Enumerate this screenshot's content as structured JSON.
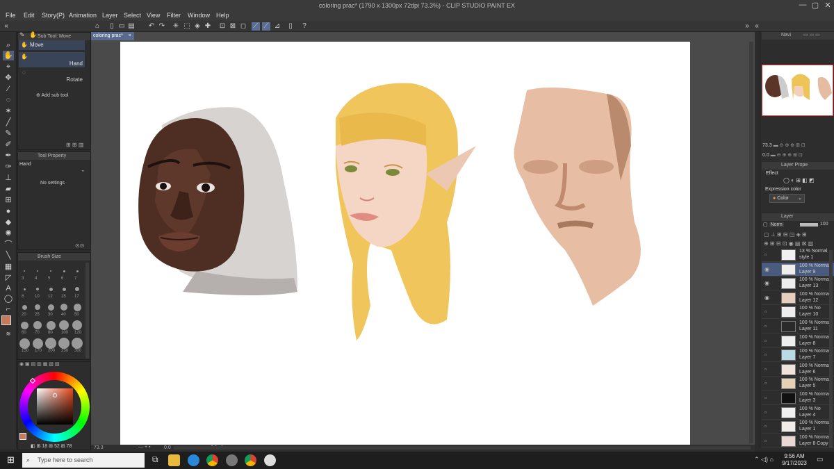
{
  "window": {
    "title": "coloring prac* (1790 x 1300px 72dpi 73.3%)  -  CLIP STUDIO PAINT EX",
    "controls": [
      "—",
      "▢",
      "✕"
    ]
  },
  "menu": [
    "File",
    "Edit",
    "Story(P)",
    "Animation",
    "Layer",
    "Select",
    "View",
    "Filter",
    "Window",
    "Help"
  ],
  "subtool_panel": {
    "header": "Sub Tool: Move",
    "items": [
      {
        "label": "Move",
        "selected": true
      },
      {
        "label": "Hand",
        "selected": true
      },
      {
        "label": "Rotate",
        "selected": false
      }
    ],
    "add_label": "Add sub tool"
  },
  "tool_property": {
    "header": "Tool Property",
    "tool_name": "Hand",
    "empty_text": "No settings"
  },
  "brush_size": {
    "header": "Brush Size",
    "sizes": [
      "3",
      "4",
      "5",
      "6",
      "7",
      "8",
      "10",
      "12",
      "15",
      "17",
      "20",
      "25",
      "30",
      "40",
      "50",
      "60",
      "70",
      "80",
      "100",
      "120",
      "150",
      "170",
      "200",
      "250",
      "300"
    ]
  },
  "color": {
    "main": "#c87a5a",
    "sub": "#ffffff",
    "readout": [
      "18",
      "52",
      "78"
    ]
  },
  "document": {
    "tab_label": "coloring prac*",
    "zoom": "73.3"
  },
  "navigator": {
    "header": "Navi",
    "zoom": "73.3",
    "angle": "0.0"
  },
  "layer_property": {
    "header": "Layer Prope",
    "effect_label": "Effect",
    "expression_label": "Expression color",
    "expression_value": "Color"
  },
  "layer_panel": {
    "header": "Layer",
    "blend_mode": "Norm",
    "opacity": "100",
    "layers": [
      {
        "mode": "13 % Normal",
        "name": "style 1",
        "selected": false,
        "visible": false
      },
      {
        "mode": "100 % Normal",
        "name": "Layer 9",
        "selected": true,
        "visible": true
      },
      {
        "mode": "100 % Normal",
        "name": "Layer 13",
        "selected": false,
        "visible": true
      },
      {
        "mode": "100 % Normal",
        "name": "Layer 12",
        "selected": false,
        "visible": true
      },
      {
        "mode": "100 % No",
        "name": "Layer 10",
        "selected": false,
        "visible": false
      },
      {
        "mode": "100 % Normal",
        "name": "Layer 11",
        "selected": false,
        "visible": false
      },
      {
        "mode": "100 % Normal",
        "name": "Layer 8",
        "selected": false,
        "visible": false
      },
      {
        "mode": "100 % Normal",
        "name": "Layer 7",
        "selected": false,
        "visible": false
      },
      {
        "mode": "100 % Normal",
        "name": "Layer 6",
        "selected": false,
        "visible": false
      },
      {
        "mode": "100 % Normal",
        "name": "Layer 5",
        "selected": false,
        "visible": false
      },
      {
        "mode": "100 % Normal",
        "name": "Layer 3",
        "selected": false,
        "visible": false
      },
      {
        "mode": "100 % No",
        "name": "Layer 4",
        "selected": false,
        "visible": false
      },
      {
        "mode": "100 % Normal",
        "name": "Layer 1",
        "selected": false,
        "visible": false
      },
      {
        "mode": "100 % Normal",
        "name": "Layer 8 Copy",
        "selected": false,
        "visible": false
      }
    ]
  },
  "taskbar": {
    "search_placeholder": "Type here to search",
    "time": "9:56 AM",
    "date": "9/17/2023"
  }
}
